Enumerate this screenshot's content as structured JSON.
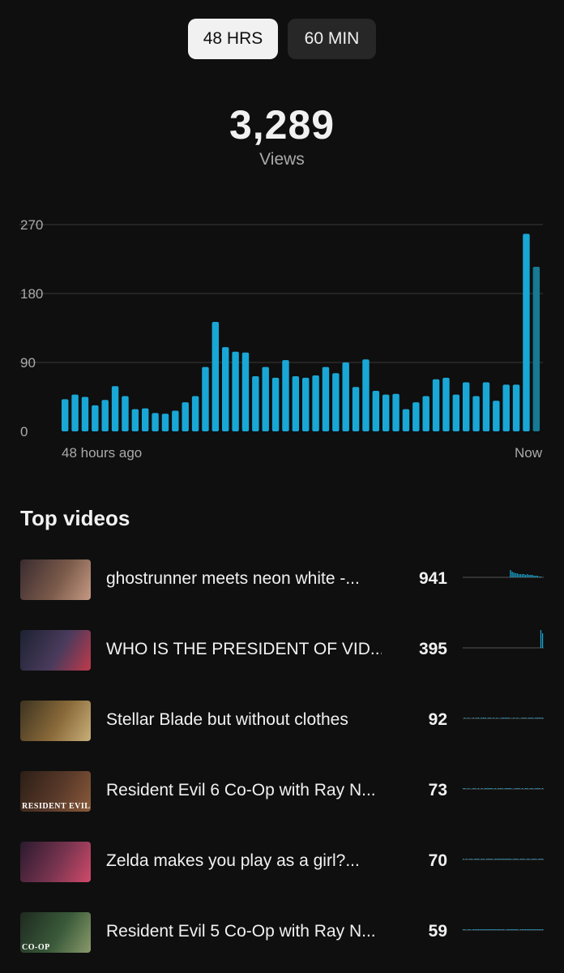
{
  "range_tabs": [
    {
      "label": "48 HRS",
      "active": true
    },
    {
      "label": "60 MIN",
      "active": false
    }
  ],
  "summary": {
    "total": "3,289",
    "label": "Views"
  },
  "chart_data": {
    "type": "bar",
    "y_ticks": [
      "270",
      "180",
      "90",
      "0"
    ],
    "ylim": [
      0,
      270
    ],
    "x_start_label": "48 hours ago",
    "x_end_label": "Now",
    "grid": true,
    "bar_color": "#19a7d6",
    "partial_bar_color": "#167a94",
    "values": [
      42,
      48,
      45,
      34,
      41,
      59,
      46,
      29,
      30,
      24,
      23,
      27,
      38,
      46,
      84,
      143,
      110,
      104,
      103,
      72,
      84,
      70,
      93,
      72,
      70,
      73,
      84,
      76,
      90,
      58,
      94,
      53,
      48,
      49,
      29,
      38,
      46,
      68,
      70,
      48,
      64,
      46,
      64,
      40,
      61,
      61,
      258,
      215
    ],
    "partial_last": true
  },
  "top_videos": {
    "title": "Top videos",
    "items": [
      {
        "title": "ghostrunner meets neon white -...",
        "views": "941",
        "thumb_colors": [
          "#3a2b30",
          "#7a5a4a",
          "#c79a84"
        ],
        "thumb_caption": "",
        "spark": [
          0,
          0,
          0,
          0,
          0,
          0,
          0,
          0,
          0,
          0,
          0,
          0,
          0,
          0,
          0,
          0,
          0,
          0,
          0,
          0,
          0,
          0,
          0,
          0,
          0,
          0,
          0,
          0,
          9,
          7,
          6,
          5,
          5,
          4,
          4,
          4,
          4,
          3,
          4,
          3,
          3,
          3,
          2,
          2,
          2,
          1,
          1,
          0
        ]
      },
      {
        "title": "WHO IS THE PRESIDENT OF VID...",
        "views": "395",
        "thumb_colors": [
          "#1c2232",
          "#4a3b5c",
          "#c0394a"
        ],
        "thumb_caption": "",
        "spark": [
          0,
          0,
          0,
          0,
          0,
          0,
          0,
          0,
          0,
          0,
          0,
          0,
          0,
          0,
          0,
          0,
          0,
          0,
          0,
          0,
          0,
          0,
          0,
          0,
          0,
          0,
          0,
          0,
          0,
          0,
          0,
          0,
          0,
          0,
          0,
          0,
          0,
          0,
          0,
          0,
          0,
          0,
          0,
          0,
          0,
          0,
          22,
          18
        ]
      },
      {
        "title": "Stellar Blade but without clothes",
        "views": "92",
        "thumb_colors": [
          "#3d3320",
          "#8a6a3a",
          "#c8b07a"
        ],
        "thumb_caption": "",
        "spark": [
          0,
          1,
          0,
          1,
          0,
          0,
          1,
          0,
          1,
          1,
          0,
          1,
          1,
          1,
          0,
          1,
          1,
          0,
          1,
          0,
          1,
          0,
          0,
          1,
          1,
          1,
          1,
          1,
          0,
          0,
          1,
          0,
          1,
          0,
          0,
          1,
          1,
          1,
          0,
          1,
          1,
          1,
          0,
          1,
          1,
          1,
          1,
          1
        ]
      },
      {
        "title": "Resident Evil 6 Co-Op with Ray N...",
        "views": "73",
        "thumb_colors": [
          "#2c1e16",
          "#5a3a2a",
          "#8a5a3a"
        ],
        "thumb_caption": "RESIDENT EVIL",
        "spark": [
          1,
          1,
          0,
          1,
          0,
          0,
          1,
          1,
          0,
          1,
          0,
          1,
          0,
          1,
          1,
          1,
          1,
          1,
          0,
          1,
          0,
          1,
          1,
          1,
          0,
          1,
          1,
          1,
          1,
          0,
          0,
          1,
          1,
          1,
          0,
          1,
          0,
          1,
          1,
          0,
          1,
          1,
          0,
          1,
          1,
          1,
          0,
          1
        ]
      },
      {
        "title": "Zelda makes you play as a girl?...",
        "views": "70",
        "thumb_colors": [
          "#2a1a2e",
          "#7a3550",
          "#d04a6a"
        ],
        "thumb_caption": "",
        "spark": [
          1,
          0,
          1,
          0,
          1,
          1,
          0,
          1,
          1,
          1,
          0,
          1,
          1,
          0,
          1,
          1,
          1,
          1,
          0,
          1,
          1,
          1,
          1,
          1,
          1,
          1,
          1,
          1,
          1,
          0,
          1,
          1,
          1,
          0,
          1,
          1,
          1,
          0,
          1,
          1,
          0,
          1,
          1,
          1,
          0,
          1,
          1,
          1
        ]
      },
      {
        "title": "Resident Evil 5 Co-Op with Ray N...",
        "views": "59",
        "thumb_colors": [
          "#1e2a20",
          "#3a5a3a",
          "#8a9a6a"
        ],
        "thumb_caption": "CO-OP",
        "spark": [
          1,
          1,
          0,
          1,
          1,
          0,
          1,
          1,
          1,
          1,
          1,
          1,
          1,
          1,
          1,
          1,
          1,
          1,
          1,
          1,
          1,
          1,
          1,
          1,
          1,
          0,
          1,
          1,
          1,
          1,
          1,
          1,
          1,
          0,
          1,
          1,
          1,
          1,
          1,
          1,
          1,
          1,
          1,
          1,
          1,
          1,
          1,
          1
        ]
      }
    ]
  }
}
